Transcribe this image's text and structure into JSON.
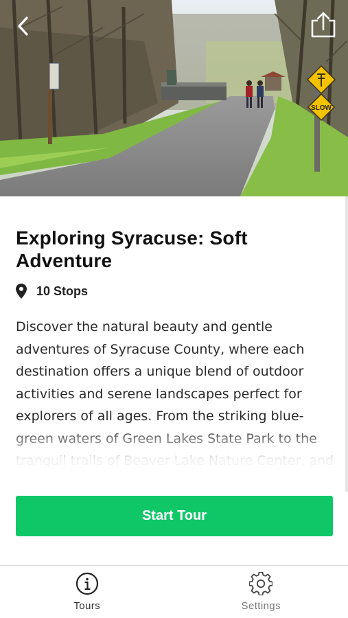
{
  "tour": {
    "title": "Exploring Syracuse: Soft Adventure",
    "stops": "10 Stops",
    "description": "Discover the natural beauty and gentle adventures of Syracuse County, where each destination offers a unique blend of outdoor activities and serene landscapes perfect for explorers of all ages. From the striking blue-green waters of Green Lakes State Park to the tranquil trails of Beaver Lake Nature Center, and beyond."
  },
  "hero": {
    "sign_text": "SLOW",
    "icons": {
      "back": "chevron-left-icon",
      "share": "share-icon"
    }
  },
  "actions": {
    "start_label": "Start Tour"
  },
  "tabbar": {
    "tabs": [
      {
        "label": "Tours",
        "icon": "info-circle-icon",
        "active": true
      },
      {
        "label": "Settings",
        "icon": "gear-icon",
        "active": false
      }
    ]
  },
  "colors": {
    "accent": "#10c768",
    "sign_yellow": "#f2c200"
  }
}
